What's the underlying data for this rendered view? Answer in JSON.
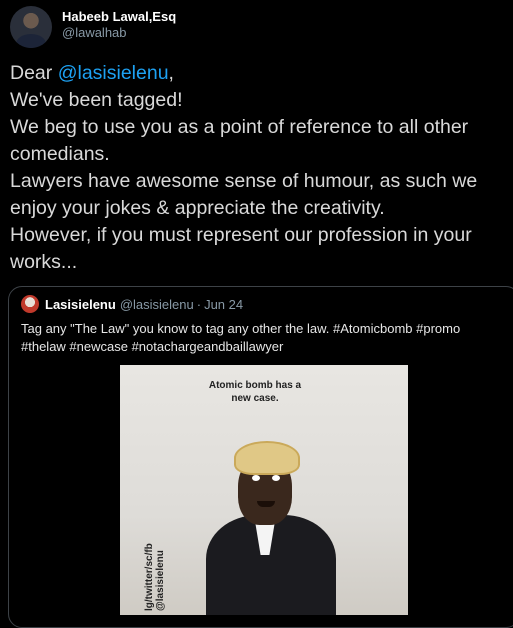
{
  "author": {
    "display_name": "Habeeb Lawal,Esq",
    "handle": "@lawalhab"
  },
  "tweet": {
    "greeting_prefix": "Dear ",
    "mention": "@lasisielenu",
    "greeting_suffix": ",",
    "lines": [
      "We've been tagged!",
      "We beg to use you as a point of reference to all other comedians.",
      "Lawyers have awesome sense of humour, as such we enjoy your jokes & appreciate the creativity.",
      "However, if you must represent our profession in your works..."
    ]
  },
  "quoted": {
    "display_name": "Lasisielenu",
    "handle": "@lasisielenu",
    "separator": "·",
    "date": "Jun 24",
    "text": "Tag any \"The Law\" you know to tag any other the law.  #Atomicbomb #promo #thelaw #newcase #notachargeandbaillawyer",
    "media": {
      "caption": "Atomic bomb has a new case.",
      "watermark_line1": "lg/twitter/sc/fb",
      "watermark_line2": "@lasisielenu"
    }
  },
  "colors": {
    "background": "#000000",
    "link": "#1da1f2",
    "muted": "#8899a6"
  }
}
